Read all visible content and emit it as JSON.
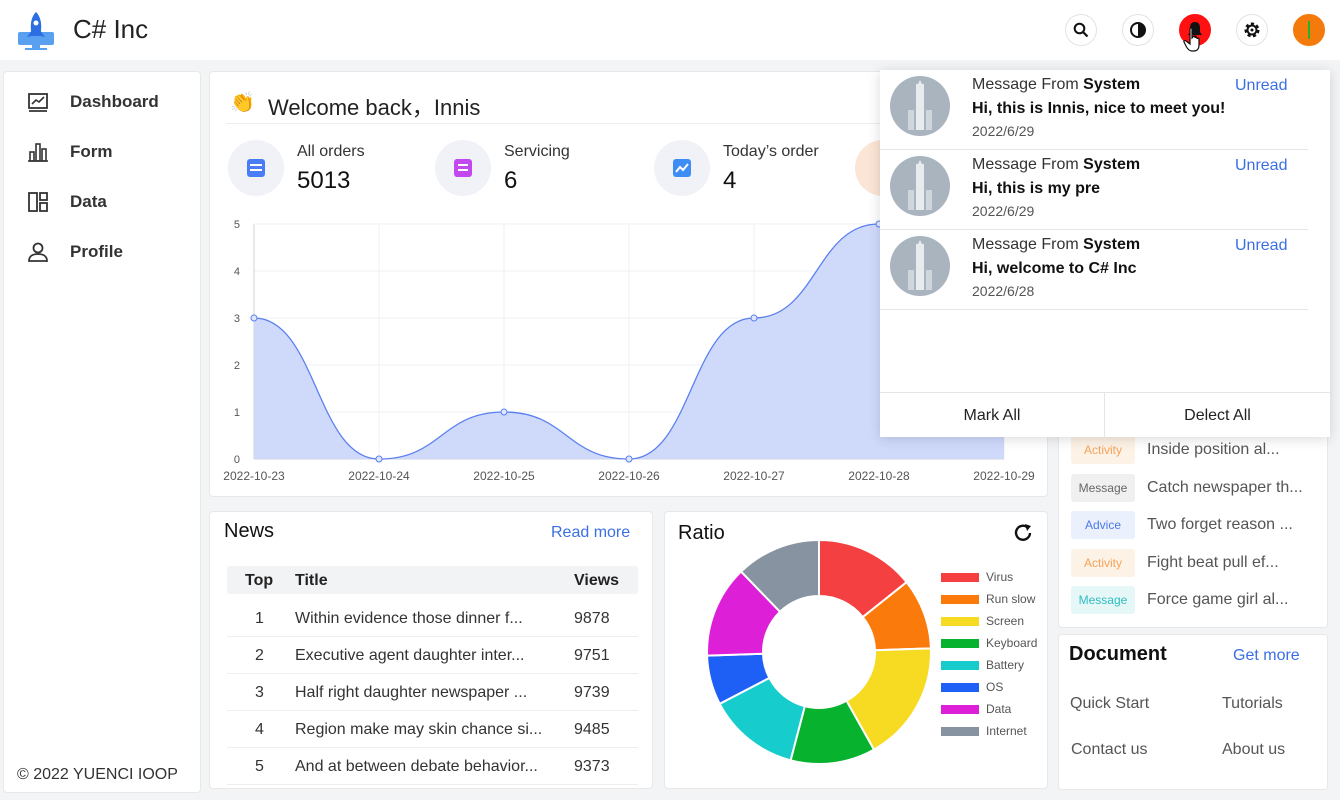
{
  "header": {
    "title": "C# Inc"
  },
  "sidebar": {
    "items": [
      {
        "label": "Dashboard",
        "icon": "dashboard-icon"
      },
      {
        "label": "Form",
        "icon": "bar-chart-icon"
      },
      {
        "label": "Data",
        "icon": "layout-icon"
      },
      {
        "label": "Profile",
        "icon": "user-icon"
      }
    ],
    "copyright": "© 2022 YUENCI IOOP"
  },
  "welcome": {
    "greeting": "Welcome back，Innis",
    "stats": [
      {
        "label": "All orders",
        "value": "5013",
        "color": "#4a7cf6"
      },
      {
        "label": "Servicing",
        "value": "6",
        "color": "#c348f0"
      },
      {
        "label": "Today’s order",
        "value": "4",
        "color": "#3d8df5"
      }
    ]
  },
  "chart_data": {
    "type": "area",
    "x": [
      "2022-10-23",
      "2022-10-24",
      "2022-10-25",
      "2022-10-26",
      "2022-10-27",
      "2022-10-28",
      "2022-10-29"
    ],
    "values": [
      3,
      0,
      1,
      0,
      3,
      5,
      5
    ],
    "yticks": [
      "0",
      "1",
      "2",
      "3",
      "4",
      "5"
    ],
    "ylim": [
      0,
      5
    ],
    "grid": true,
    "color": "#5b7ff0",
    "fill": "#ccd8fb"
  },
  "news": {
    "title": "News",
    "read_more": "Read more",
    "columns": {
      "top": "Top",
      "title": "Title",
      "views": "Views"
    },
    "rows": [
      {
        "top": "1",
        "title": "Within evidence those dinner f...",
        "views": "9878"
      },
      {
        "top": "2",
        "title": "Executive agent daughter inter...",
        "views": "9751"
      },
      {
        "top": "3",
        "title": "Half right daughter newspaper ...",
        "views": "9739"
      },
      {
        "top": "4",
        "title": "Region make may skin chance si...",
        "views": "9485"
      },
      {
        "top": "5",
        "title": "And at between debate behavior...",
        "views": "9373"
      }
    ]
  },
  "ratio": {
    "title": "Ratio",
    "legend": [
      {
        "name": "Virus",
        "color": "#f44040"
      },
      {
        "name": "Run slow",
        "color": "#fb7a0c"
      },
      {
        "name": "Screen",
        "color": "#f7da22"
      },
      {
        "name": "Keyboard",
        "color": "#06b22e"
      },
      {
        "name": "Battery",
        "color": "#17cccc"
      },
      {
        "name": "OS",
        "color": "#1e5ff5"
      },
      {
        "name": "Data",
        "color": "#dd1fd8"
      },
      {
        "name": "Internet",
        "color": "#8793a1"
      }
    ],
    "slices": [
      14,
      10,
      17,
      12,
      13,
      7,
      13,
      12
    ]
  },
  "activity": {
    "rows": [
      {
        "tag": "Activity",
        "text": "Inside position al...",
        "tag_color": "#f5a35b",
        "tag_bg": "#fdf2e6"
      },
      {
        "tag": "Message",
        "text": "Catch newspaper th...",
        "tag_color": "#666666",
        "tag_bg": "#f0f0f0"
      },
      {
        "tag": "Advice",
        "text": "Two forget reason ...",
        "tag_color": "#4b78e8",
        "tag_bg": "#eaf1fd"
      },
      {
        "tag": "Activity",
        "text": "Fight beat pull ef...",
        "tag_color": "#f5a35b",
        "tag_bg": "#fdf2e6"
      },
      {
        "tag": "Message",
        "text": "Force game girl al...",
        "tag_color": "#2ebdc0",
        "tag_bg": "#e6f7f7"
      }
    ]
  },
  "document": {
    "title": "Document",
    "get_more": "Get more",
    "links": [
      "Quick Start",
      "Tutorials",
      "Contact us",
      "About us"
    ]
  },
  "notifications": {
    "messages": [
      {
        "from_prefix": "Message From",
        "from": "System",
        "text": "Hi, this is Innis, nice to meet you!",
        "date": "2022/6/29",
        "status": "Unread"
      },
      {
        "from_prefix": "Message From",
        "from": "System",
        "text": "Hi, this is my pre",
        "date": "2022/6/29",
        "status": "Unread"
      },
      {
        "from_prefix": "Message From",
        "from": "System",
        "text": "Hi, welcome to C# Inc",
        "date": "2022/6/28",
        "status": "Unread"
      }
    ],
    "mark_all": "Mark All",
    "delete_all": "Delect All"
  }
}
